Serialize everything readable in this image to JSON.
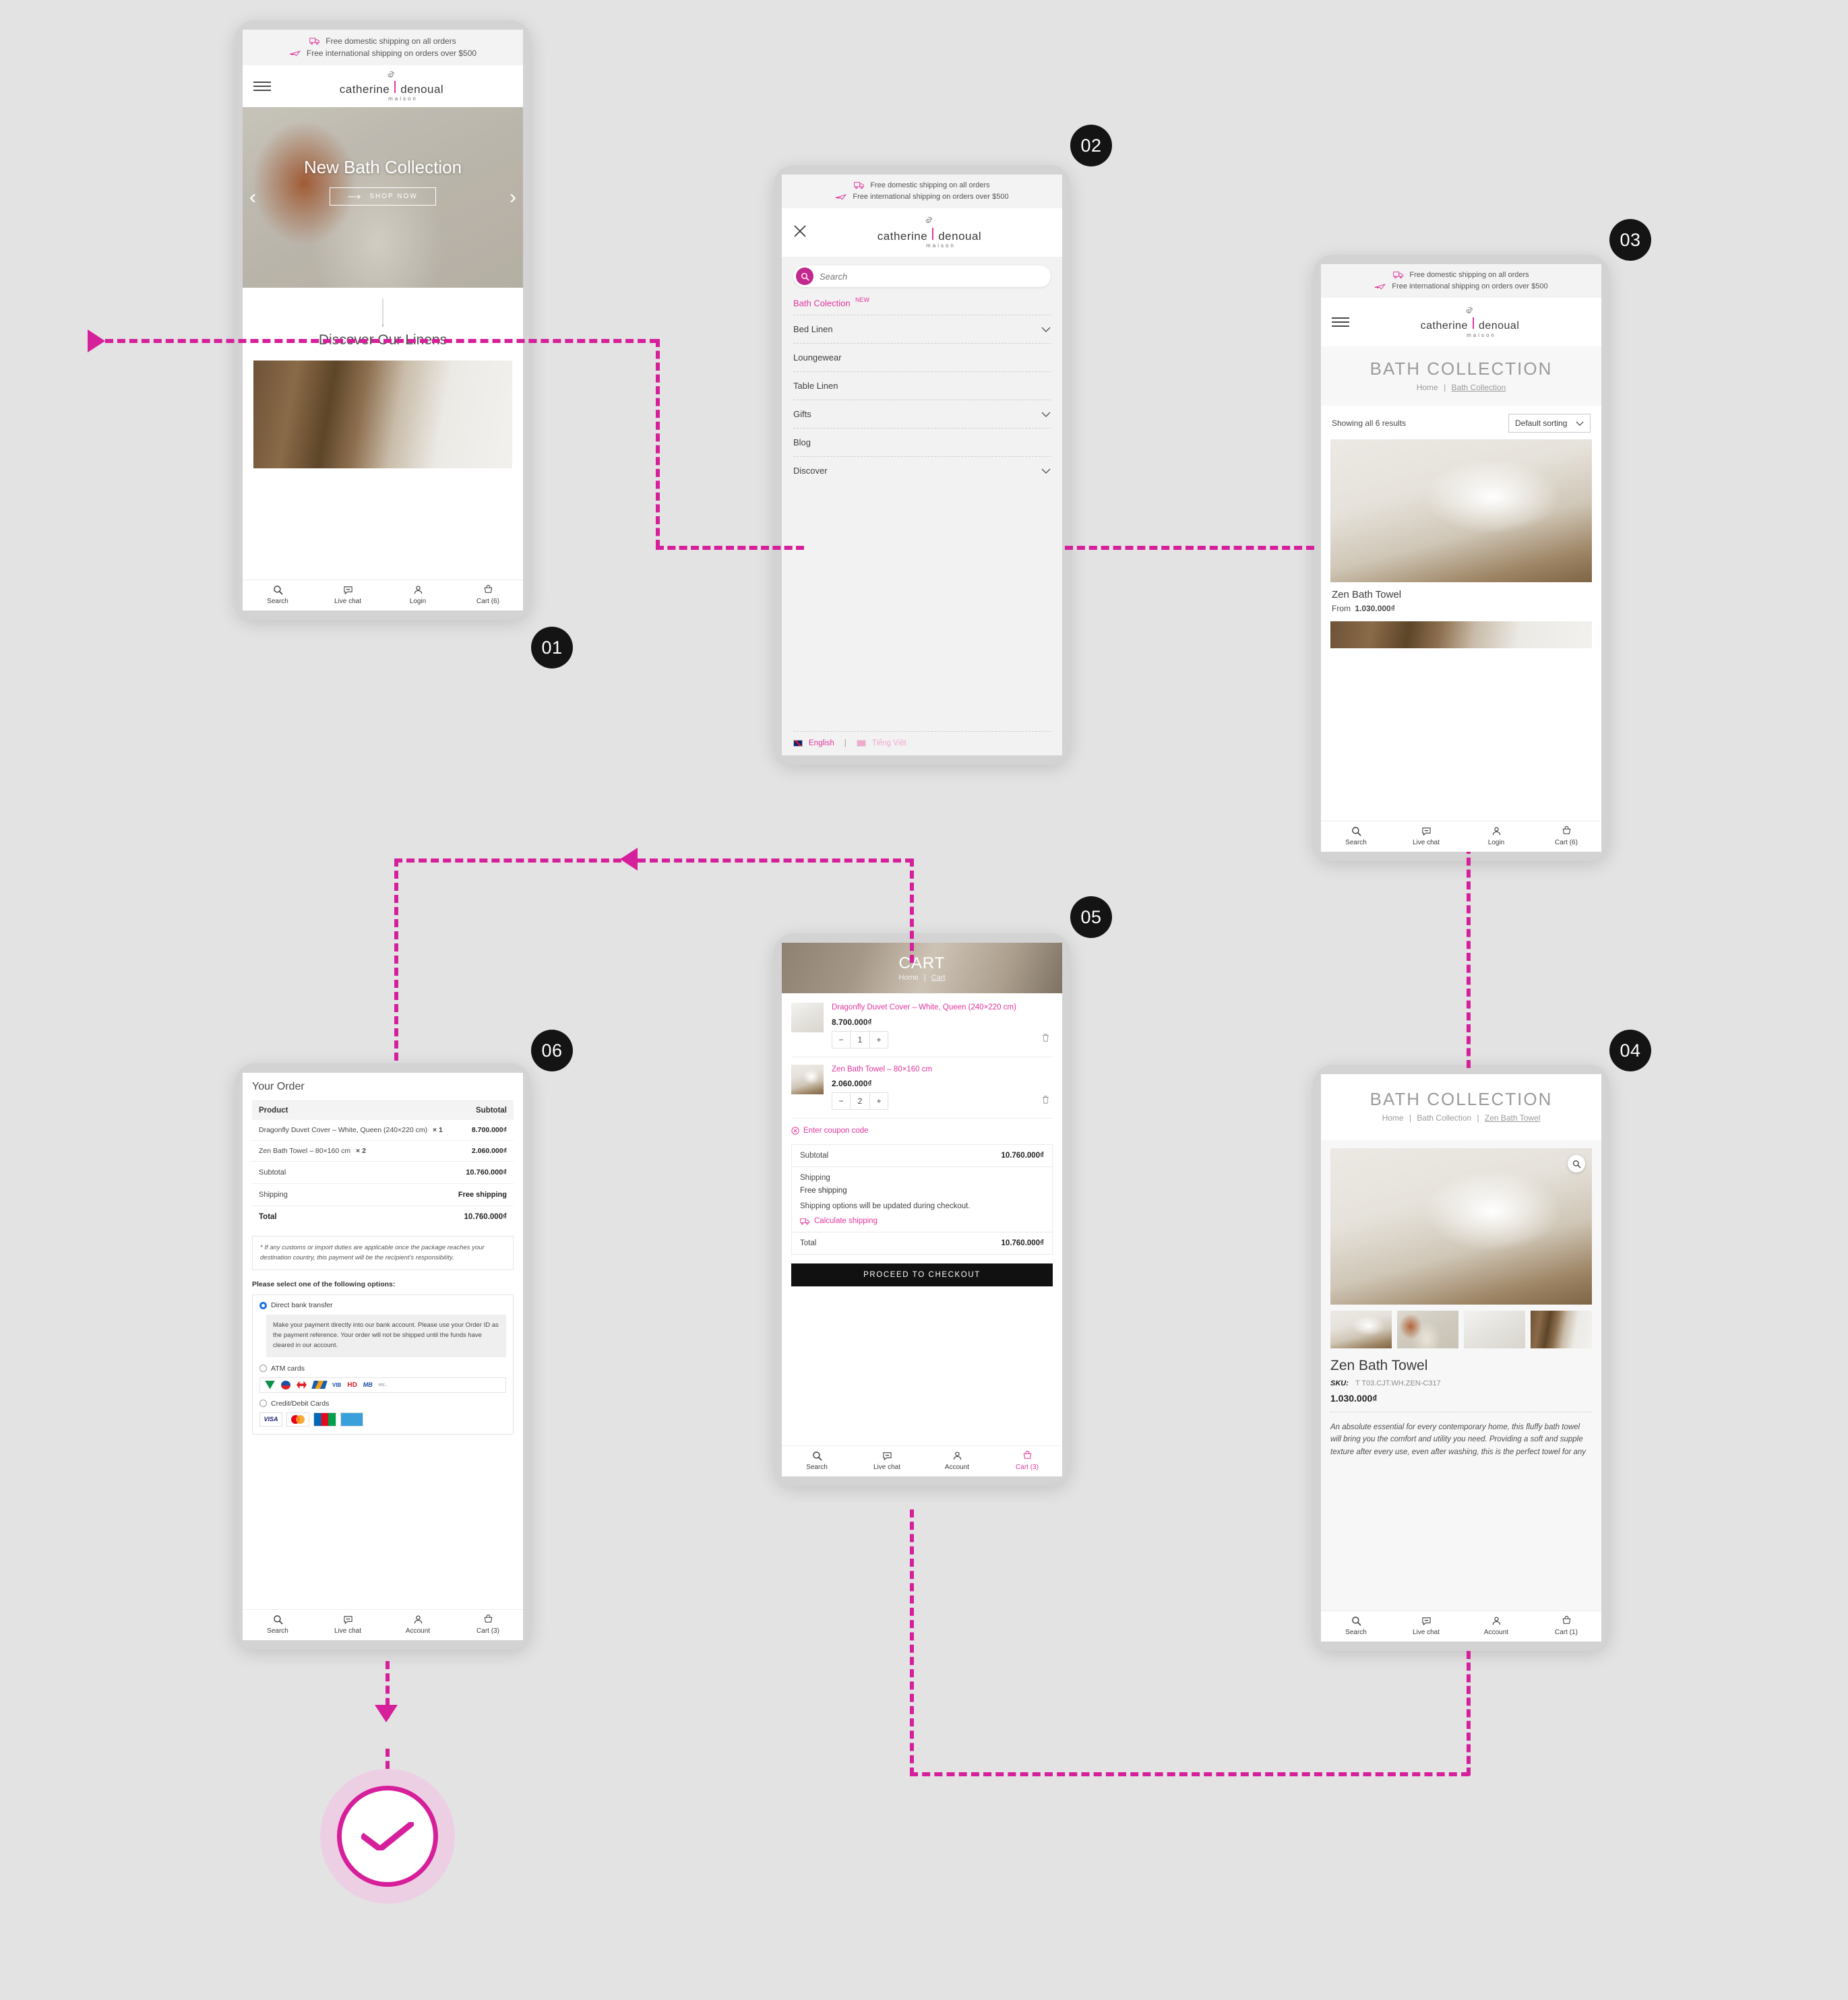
{
  "brand": {
    "name_left": "catherine",
    "name_right": "denoual",
    "subtitle": "maison",
    "accent": "#e0359c",
    "dark": "#141414"
  },
  "shipping_bar": {
    "line1": "Free domestic shipping on all orders",
    "line2": "Free international shipping on orders over $500"
  },
  "bottom_nav_home": [
    {
      "icon": "search-icon",
      "label": "Search"
    },
    {
      "icon": "chat-icon",
      "label": "Live chat"
    },
    {
      "icon": "user-icon",
      "label": "Login"
    },
    {
      "icon": "cart-icon",
      "label": "Cart (6)"
    }
  ],
  "bottom_nav_listing": [
    {
      "icon": "search-icon",
      "label": "Search"
    },
    {
      "icon": "chat-icon",
      "label": "Live chat"
    },
    {
      "icon": "user-icon",
      "label": "Login"
    },
    {
      "icon": "cart-icon",
      "label": "Cart (6)"
    }
  ],
  "bottom_nav_product": [
    {
      "icon": "search-icon",
      "label": "Search"
    },
    {
      "icon": "chat-icon",
      "label": "Live chat"
    },
    {
      "icon": "user-icon",
      "label": "Account"
    },
    {
      "icon": "cart-icon",
      "label": "Cart (1)"
    }
  ],
  "bottom_nav_cart": [
    {
      "icon": "search-icon",
      "label": "Search"
    },
    {
      "icon": "chat-icon",
      "label": "Live chat"
    },
    {
      "icon": "user-icon",
      "label": "Account"
    },
    {
      "icon": "cart-icon",
      "label": "Cart (3)"
    }
  ],
  "bottom_nav_checkout": [
    {
      "icon": "search-icon",
      "label": "Search"
    },
    {
      "icon": "chat-icon",
      "label": "Live chat"
    },
    {
      "icon": "user-icon",
      "label": "Account"
    },
    {
      "icon": "cart-icon",
      "label": "Cart (3)"
    }
  ],
  "steps": [
    {
      "number": "01"
    },
    {
      "number": "02"
    },
    {
      "number": "03"
    },
    {
      "number": "04"
    },
    {
      "number": "05"
    },
    {
      "number": "06"
    }
  ],
  "screen01": {
    "hero_title": "New Bath Collection",
    "hero_cta": "SHOP NOW",
    "section_title": "Discover Our Linens",
    "prev": "‹",
    "next": "›"
  },
  "screen02": {
    "search_placeholder": "Search",
    "featured": {
      "label": "Bath Colection",
      "badge": "NEW"
    },
    "items": [
      {
        "label": "Bed Linen",
        "chevron": true
      },
      {
        "label": "Loungewear",
        "chevron": false
      },
      {
        "label": "Table Linen",
        "chevron": false
      },
      {
        "label": "Gifts",
        "chevron": true
      },
      {
        "label": "Blog",
        "chevron": false
      },
      {
        "label": "Discover",
        "chevron": true
      }
    ],
    "languages": [
      {
        "label": "English",
        "active": true
      },
      {
        "label": "Tiếng Việt",
        "active": false
      }
    ],
    "lang_divider": "|"
  },
  "screen03": {
    "page_title": "BATH COLLECTION",
    "crumb_home": "Home",
    "crumb_sep": "|",
    "crumb_current": "Bath Collection",
    "results_text": "Showing all 6 results",
    "sort_value": "Default sorting",
    "product": {
      "name": "Zen Bath Towel",
      "price_prefix": "From",
      "price": "1.030.000₫"
    }
  },
  "screen04": {
    "page_title": "BATH COLLECTION",
    "crumb_home": "Home",
    "crumb_collection": "Bath Collection",
    "crumb_current": "Zen Bath Towel",
    "crumb_sep": "|",
    "product_name": "Zen Bath Towel",
    "sku_label": "SKU:",
    "sku_value": "T T03.CJT.WH.ZEN-C317",
    "price": "1.030.000₫",
    "description": "An absolute essential for every contemporary home, this fluffy bath towel will bring you the comfort and utility you need. Providing a soft and supple texture after every use, even after washing, this is the perfect towel for any"
  },
  "screen05": {
    "page_title": "CART",
    "crumb_home": "Home",
    "crumb_sep": "|",
    "crumb_current": "Cart",
    "items": [
      {
        "name": "Dragonfly Duvet Cover – White, Queen (240×220 cm)",
        "price": "8.700.000₫",
        "qty": "1"
      },
      {
        "name": "Zen Bath Towel – 80×160 cm",
        "price": "2.060.000₫",
        "qty": "2"
      }
    ],
    "coupon_link": "Enter coupon code",
    "subtotal_label": "Subtotal",
    "subtotal_value": "10.760.000₫",
    "shipping_label": "Shipping",
    "shipping_value": "Free shipping",
    "shipping_note": "Shipping options will be updated during checkout.",
    "calculate_link": "Calculate shipping",
    "total_label": "Total",
    "total_value": "10.760.000₫",
    "checkout_button": "PROCEED TO CHECKOUT",
    "qty_minus": "−",
    "qty_plus": "+"
  },
  "screen06": {
    "title": "Your Order",
    "col_product": "Product",
    "col_subtotal": "Subtotal",
    "lines": [
      {
        "name": "Dragonfly Duvet Cover – White, Queen (240×220 cm)",
        "qty": "× 1",
        "value": "8.700.000₫"
      },
      {
        "name": "Zen Bath Towel – 80×160 cm",
        "qty": "× 2",
        "value": "2.060.000₫"
      }
    ],
    "subtotal_label": "Subtotal",
    "subtotal_value": "10.760.000₫",
    "shipping_label": "Shipping",
    "shipping_value": "Free shipping",
    "total_label": "Total",
    "total_value": "10.760.000₫",
    "customs_note": "* If any customs or import duties are applicable once the package reaches your destination country, this payment will be the recipient's responsibility.",
    "options_heading": "Please select one of the following options:",
    "option_bank": "Direct bank transfer",
    "option_bank_desc": "Make your payment directly into our bank account. Please use your Order ID as the payment reference. Your order will not be shipped until the funds have cleared in our account.",
    "option_atm": "ATM cards",
    "atm_logos": [
      "VCB",
      "OCB",
      "TCB",
      "BIDV",
      "VIB",
      "HD",
      "MB",
      "etc.."
    ],
    "option_cards": "Credit/Debit Cards",
    "card_logos": [
      "VISA",
      "MasterCard",
      "JCB",
      "AMEX"
    ]
  },
  "success": {
    "icon": "check-circle-icon"
  }
}
